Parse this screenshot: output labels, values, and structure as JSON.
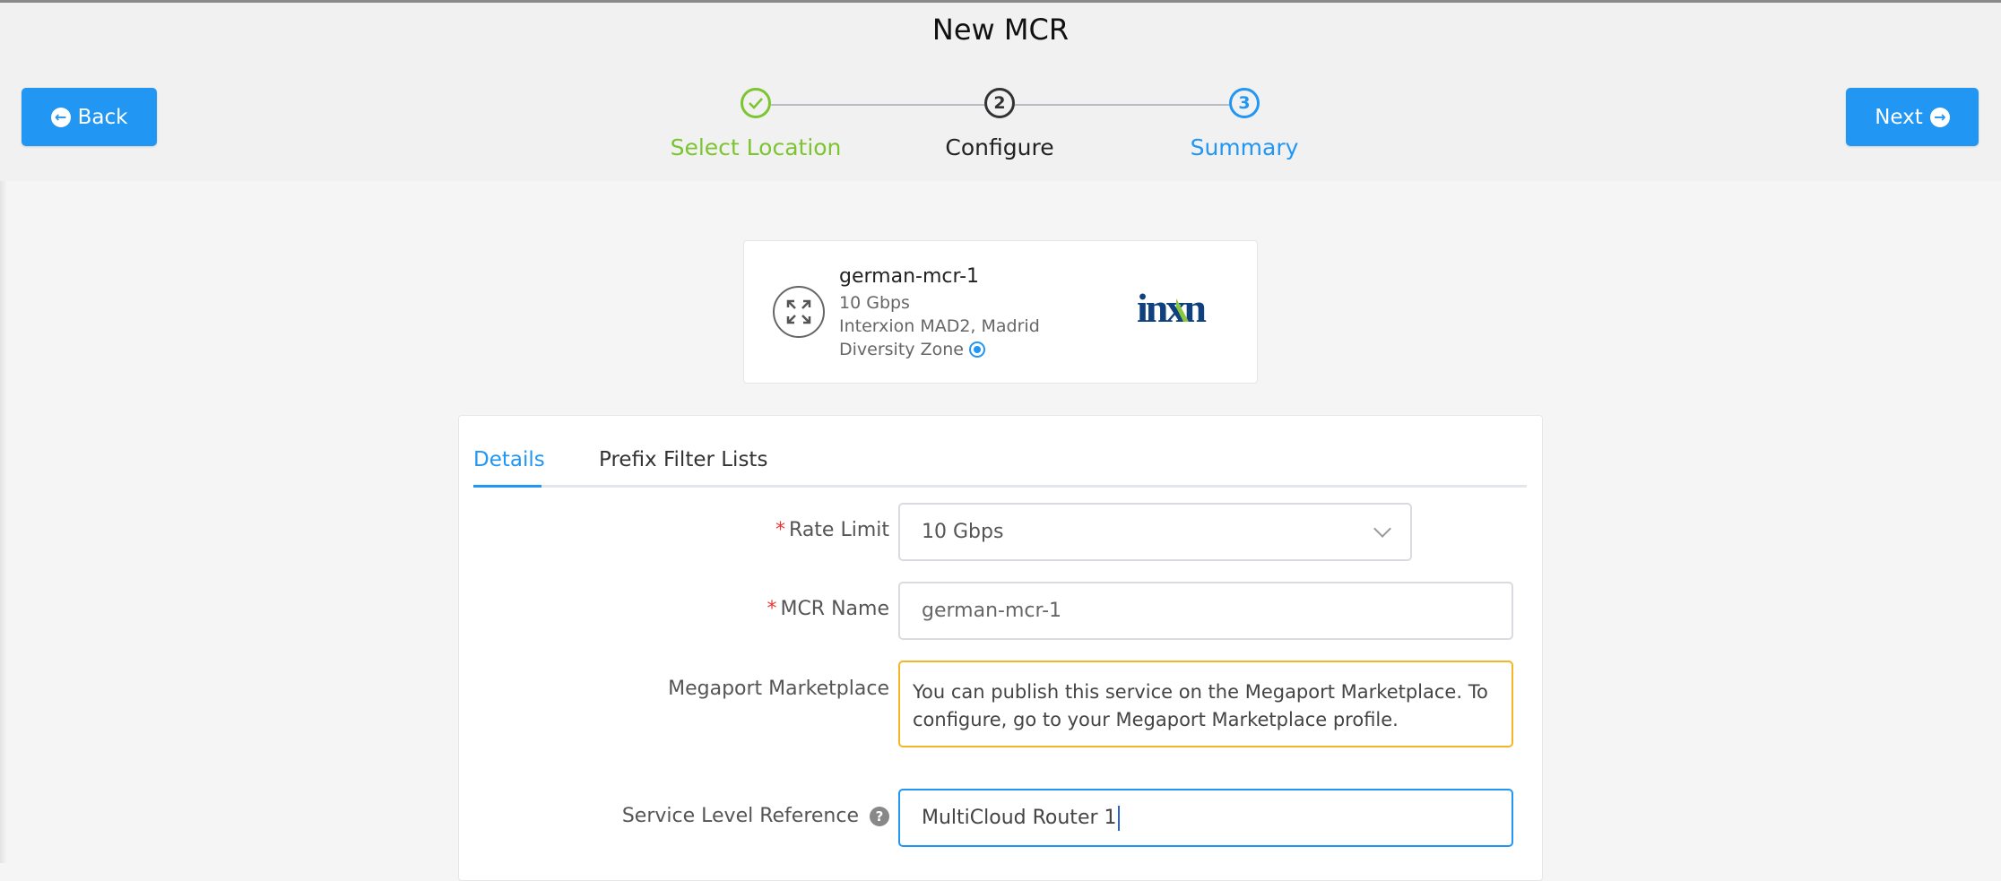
{
  "header": {
    "title": "New MCR",
    "back_label": "Back",
    "next_label": "Next"
  },
  "steps": [
    {
      "label": "Select Location",
      "state": "done",
      "number": ""
    },
    {
      "label": "Configure",
      "state": "current",
      "number": "2"
    },
    {
      "label": "Summary",
      "state": "upcoming",
      "number": "3"
    }
  ],
  "mcr_card": {
    "name": "german-mcr-1",
    "speed": "10 Gbps",
    "location": "Interxion MAD2, Madrid",
    "diversity_zone": "Diversity Zone",
    "logo_text": "inxn"
  },
  "tabs": [
    {
      "label": "Details",
      "active": true
    },
    {
      "label": "Prefix Filter Lists",
      "active": false
    }
  ],
  "form": {
    "required_mark": "*",
    "rate_limit_label": "Rate Limit",
    "rate_limit_value": "10 Gbps",
    "mcr_name_label": "MCR Name",
    "mcr_name_value": "german-mcr-1",
    "marketplace_label": "Megaport Marketplace",
    "marketplace_notice": "You can publish this service on the Megaport Marketplace. To configure, go to your Megaport Marketplace profile.",
    "service_level_label": "Service Level Reference",
    "service_level_value": "MultiCloud Router 1",
    "help_glyph": "?"
  },
  "colors": {
    "primary": "#2196f3",
    "success": "#7cc531",
    "warning": "#f5b526",
    "required": "#e53935"
  }
}
